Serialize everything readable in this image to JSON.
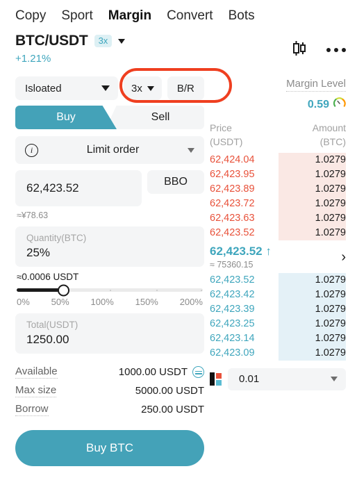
{
  "nav": {
    "items": [
      {
        "label": "Copy",
        "active": false
      },
      {
        "label": "Sport",
        "active": false
      },
      {
        "label": "Margin",
        "active": true
      },
      {
        "label": "Convert",
        "active": false
      },
      {
        "label": "Bots",
        "active": false
      }
    ]
  },
  "pair": {
    "name": "BTC/USDT",
    "leverage_badge": "3x",
    "change": "+1.21%"
  },
  "margin_mode": {
    "mode": "Isloated",
    "leverage": "3x",
    "br": "B/R"
  },
  "side_tabs": {
    "buy": "Buy",
    "sell": "Sell",
    "selected": "Buy"
  },
  "order_form": {
    "order_type": "Limit order",
    "price_value": "62,423.52",
    "bbo_label": "BBO",
    "price_approx": "≈¥78.63",
    "quantity_caption": "Quantity(BTC)",
    "quantity_value": "25%",
    "quantity_approx": "≈0.0006 USDT",
    "slider_percent": 25,
    "slider_ticks": [
      "0%",
      "50%",
      "100%",
      "150%",
      "200%"
    ],
    "total_caption": "Total(USDT)",
    "total_value": "1250.00",
    "submit_label": "Buy BTC"
  },
  "balances": [
    {
      "key": "Available",
      "value": "1000.00 USDT",
      "has_transfer_icon": true
    },
    {
      "key": "Max size",
      "value": "5000.00 USDT",
      "has_transfer_icon": false
    },
    {
      "key": "Borrow",
      "value": "250.00 USDT",
      "has_transfer_icon": false
    }
  ],
  "margin_level": {
    "label": "Margin Level",
    "value": "0.59"
  },
  "orderbook": {
    "header_price": "Price",
    "header_price_unit": "(USDT)",
    "header_amount": "Amount",
    "header_amount_unit": "(BTC)",
    "asks": [
      {
        "price": "62,424.04",
        "amount": "1.0279"
      },
      {
        "price": "62,423.95",
        "amount": "1.0279"
      },
      {
        "price": "62,423.89",
        "amount": "1.0279"
      },
      {
        "price": "62,423.72",
        "amount": "1.0279"
      },
      {
        "price": "62,423.63",
        "amount": "1.0279"
      },
      {
        "price": "62,423.52",
        "amount": "1.0279"
      }
    ],
    "mid_price": "62,423.52 ↑",
    "mid_sub": "≈ 75360.15",
    "bids": [
      {
        "price": "62,423.52",
        "amount": "1.0279"
      },
      {
        "price": "62,423.42",
        "amount": "1.0279"
      },
      {
        "price": "62,423.39",
        "amount": "1.0279"
      },
      {
        "price": "62,423.25",
        "amount": "1.0279"
      },
      {
        "price": "62,423.14",
        "amount": "1.0279"
      },
      {
        "price": "62,423.09",
        "amount": "1.0279"
      }
    ],
    "step_value": "0.01"
  },
  "colors": {
    "accent_teal": "#44a2b8",
    "ask_red": "#e8513a",
    "bid_teal": "#3fa6bd",
    "annotation": "#ef3f20"
  }
}
